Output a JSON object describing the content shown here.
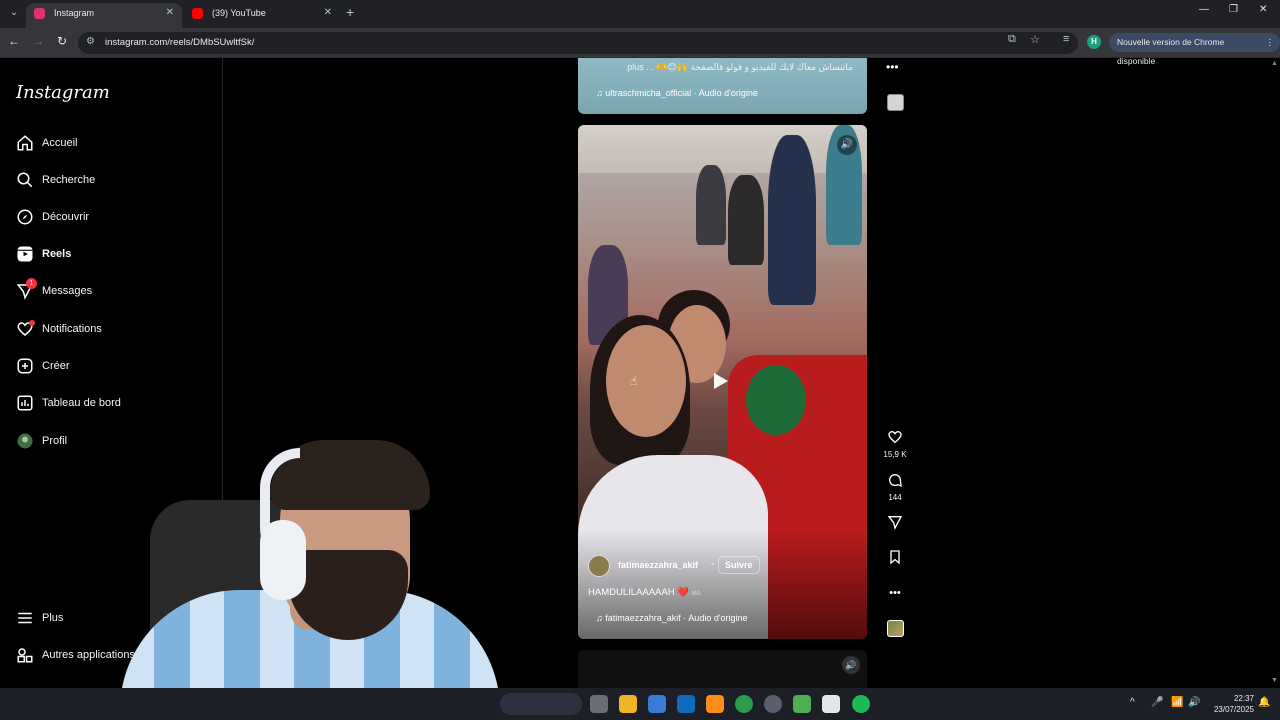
{
  "browser": {
    "tabs": [
      {
        "title": "Instagram",
        "active": true,
        "favicon_color": "#e1306c"
      },
      {
        "title": "(39) YouTube",
        "active": false,
        "favicon_color": "#ff0000"
      }
    ],
    "new_tab": "+",
    "address": "instagram.com/reels/DMbSUwltfSk/",
    "profile_initial": "H",
    "update_label": "Nouvelle version de Chrome disponible"
  },
  "instagram": {
    "logo": "Instagram",
    "nav": [
      {
        "label": "Accueil",
        "icon": "home-icon"
      },
      {
        "label": "Recherche",
        "icon": "search-icon"
      },
      {
        "label": "Découvrir",
        "icon": "compass-icon"
      },
      {
        "label": "Reels",
        "icon": "reels-icon",
        "active": true
      },
      {
        "label": "Messages",
        "icon": "messages-icon",
        "badge": "1"
      },
      {
        "label": "Notifications",
        "icon": "heart-icon",
        "dot": true
      },
      {
        "label": "Créer",
        "icon": "plus-square-icon"
      },
      {
        "label": "Tableau de bord",
        "icon": "dashboard-icon"
      },
      {
        "label": "Profil",
        "icon": "avatar-icon"
      }
    ],
    "more": {
      "label": "Plus",
      "icon": "menu-icon"
    },
    "other_apps": {
      "label": "Autres applications M",
      "icon": "apps-icon"
    }
  },
  "reels": {
    "previous": {
      "caption": "ماتنساش معاك لايك للفيديو و فولو فالصفحة 🙌😊🫶 ... plus",
      "audio": "ultraschmicha_official · Audio d'origine"
    },
    "current": {
      "author": "fatimaezzahra_akif",
      "separator": "•",
      "follow_label": "Suivre",
      "caption": "HAMDULILAAAAAH",
      "caption_heart": "❤️",
      "caption_flag": "MA",
      "audio": "fatimaezzahra_akif · Audio d'origine",
      "likes": "15,9 K",
      "comments": "144"
    },
    "accent_color": "#b91c1c"
  },
  "taskbar": {
    "time": "22:37",
    "date": "23/07/2025"
  }
}
